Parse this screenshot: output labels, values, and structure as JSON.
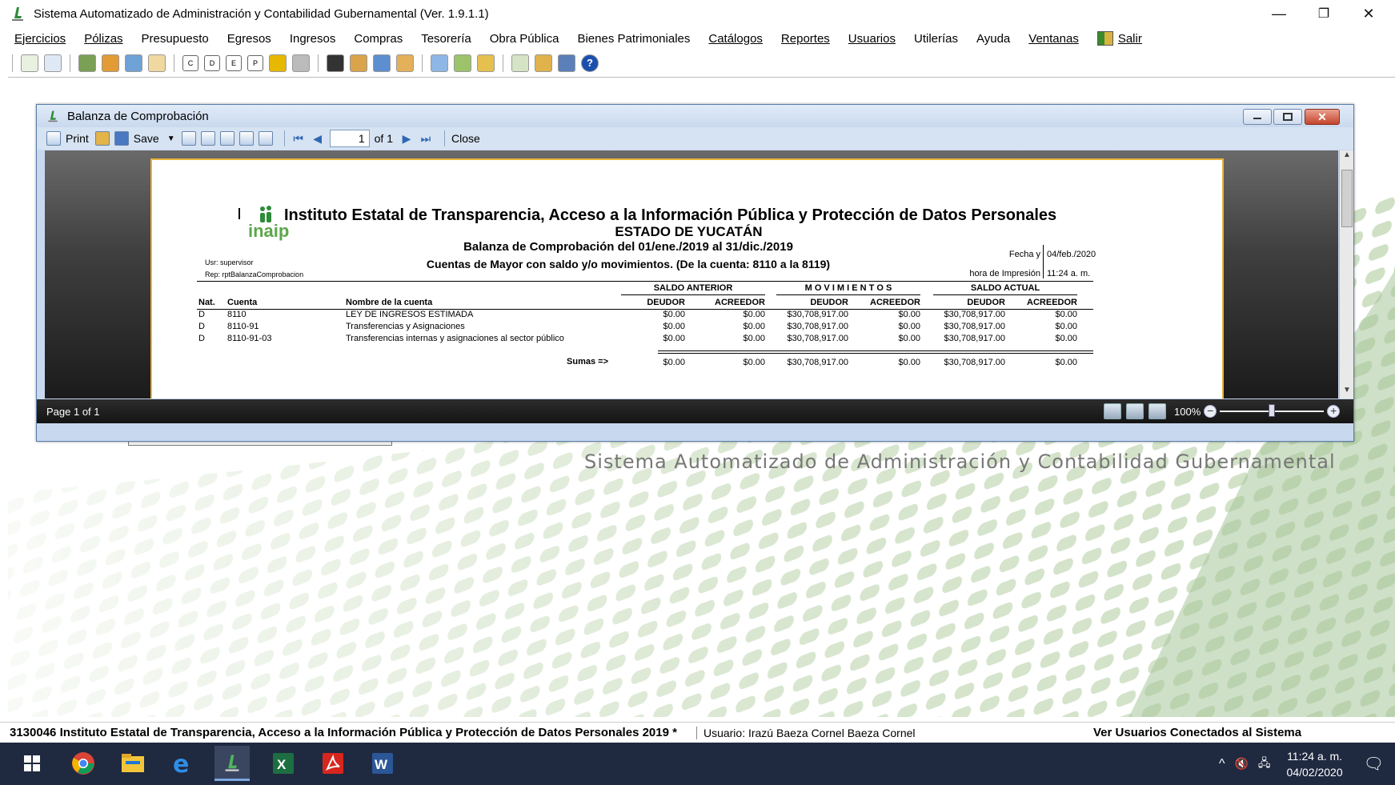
{
  "window": {
    "title": "Sistema Automatizado de Administración y Contabilidad Gubernamental  (Ver. 1.9.1.1)",
    "minimize": "—",
    "restore": "❐",
    "close": "✕"
  },
  "menu": [
    {
      "label": "Ejercicios",
      "underline": true
    },
    {
      "label": "Pólizas",
      "underline": true
    },
    {
      "label": "Presupuesto",
      "underline": false
    },
    {
      "label": "Egresos",
      "underline": false
    },
    {
      "label": "Ingresos",
      "underline": false
    },
    {
      "label": "Compras",
      "underline": false
    },
    {
      "label": "Tesorería",
      "underline": false
    },
    {
      "label": "Obra Pública",
      "underline": false
    },
    {
      "label": "Bienes Patrimoniales",
      "underline": false
    },
    {
      "label": "Catálogos",
      "underline": true
    },
    {
      "label": "Reportes",
      "underline": true
    },
    {
      "label": "Usuarios",
      "underline": true
    },
    {
      "label": "Utilerías",
      "underline": false
    },
    {
      "label": "Ayuda",
      "underline": false
    },
    {
      "label": "Ventanas",
      "underline": true
    }
  ],
  "menu_exit": "Salir",
  "toolbar_letters": [
    "C",
    "D",
    "E",
    "P"
  ],
  "background_text": "Sistema Automatizado de Administración y Contabilidad Gubernamental",
  "viewer": {
    "title": "Balanza de Comprobación",
    "toolbar": {
      "print": "Print",
      "save": "Save",
      "page": "1",
      "of": "of 1",
      "close": "Close"
    },
    "status": "Page 1 of 1",
    "zoom": "100%",
    "zoom_level": 0.5
  },
  "report": {
    "org_line": "Instituto Estatal de Transparencia, Acceso a la Información Pública y Protección de Datos Personales",
    "state": "ESTADO DE YUCATÁN",
    "title": "Balanza de Comprobación del 01/ene./2019 al 31/dic./2019",
    "subtitle": "Cuentas de Mayor con saldo y/o movimientos. (De la cuenta: 8110 a la 8119)",
    "logo_text": "inaip",
    "usr": "Usr: supervisor",
    "rep": "Rep: rptBalanzaComprobacion",
    "fecha_label": "Fecha y",
    "fecha_value": "04/feb./2020",
    "hora_label": "hora de Impresión",
    "hora_value": "11:24 a. m.",
    "groups": {
      "anterior": "SALDO ANTERIOR",
      "movimientos": "M O V I M I E N T O S",
      "actual": "SALDO ACTUAL"
    },
    "columns": {
      "nat": "Nat.",
      "cuenta": "Cuenta",
      "nombre": "Nombre de la cuenta",
      "deudor": "DEUDOR",
      "acreedor": "ACREEDOR"
    },
    "rows": [
      {
        "nat": "D",
        "cuenta": "8110",
        "nombre": "LEY DE INGRESOS ESTIMADA",
        "ant_d": "$0.00",
        "ant_a": "$0.00",
        "mov_d": "$30,708,917.00",
        "mov_a": "$0.00",
        "act_d": "$30,708,917.00",
        "act_a": "$0.00"
      },
      {
        "nat": "D",
        "cuenta": "8110-91",
        "nombre": "Transferencias y Asignaciones",
        "ant_d": "$0.00",
        "ant_a": "$0.00",
        "mov_d": "$30,708,917.00",
        "mov_a": "$0.00",
        "act_d": "$30,708,917.00",
        "act_a": "$0.00"
      },
      {
        "nat": "D",
        "cuenta": "8110-91-03",
        "nombre": "Transferencias internas y asignaciones al sector público",
        "ant_d": "$0.00",
        "ant_a": "$0.00",
        "mov_d": "$30,708,917.00",
        "mov_a": "$0.00",
        "act_d": "$30,708,917.00",
        "act_a": "$0.00"
      }
    ],
    "totals": {
      "label": "Sumas =>",
      "ant_d": "$0.00",
      "ant_a": "$0.00",
      "mov_d": "$30,708,917.00",
      "mov_a": "$0.00",
      "act_d": "$30,708,917.00",
      "act_a": "$0.00"
    }
  },
  "statusbar": {
    "org": "3130046 Instituto Estatal de Transparencia, Acceso a la Información Pública y Protección de Datos Personales  2019   *",
    "user": "Usuario: Irazú Baeza Cornel Baeza Cornel",
    "connected": "Ver Usuarios Conectados al Sistema"
  },
  "taskbar": {
    "time": "11:24 a. m.",
    "date": "04/02/2020",
    "apps": [
      "start-icon",
      "chrome-icon",
      "file-explorer-icon",
      "edge-icon",
      "saacg-icon",
      "excel-icon",
      "acrobat-icon",
      "word-icon"
    ]
  },
  "colors": {
    "brand_green": "#2e8b3a",
    "dialog_frame": "#c8d9ef",
    "taskbar": "#1f2940",
    "report_border": "#e8b33c"
  }
}
